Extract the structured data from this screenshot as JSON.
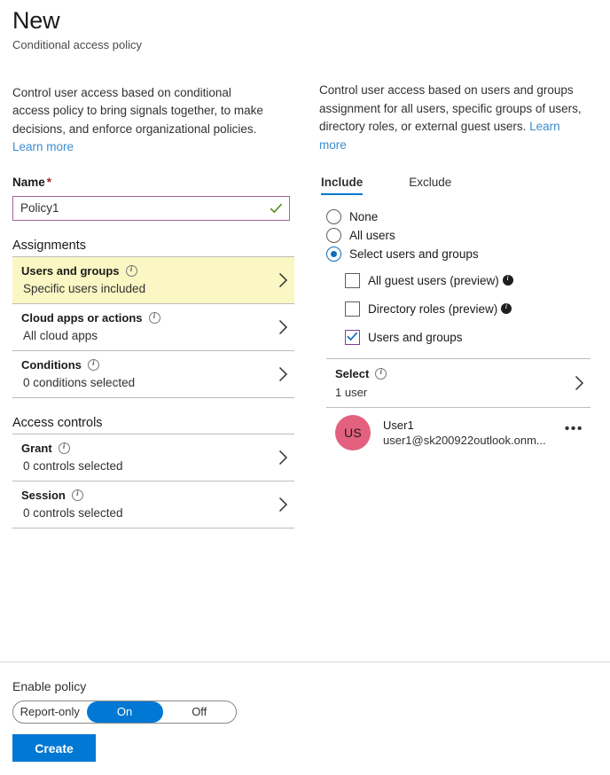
{
  "blade": {
    "title": "New",
    "subtitle": "Conditional access policy"
  },
  "left": {
    "intro_text": "Control user access based on conditional access policy to bring signals together, to make decisions, and enforce organizational policies. ",
    "intro_link": "Learn more",
    "name_label": "Name",
    "name_required_mark": "*",
    "name_value": "Policy1",
    "name_placeholder": "",
    "assignments_heading": "Assignments",
    "assignment_rows": [
      {
        "title": "Users and groups",
        "value": "Specific users included"
      },
      {
        "title": "Cloud apps or actions",
        "value": "All cloud apps"
      },
      {
        "title": "Conditions",
        "value": "0 conditions selected"
      }
    ],
    "access_controls_heading": "Access controls",
    "control_rows": [
      {
        "title": "Grant",
        "value": "0 controls selected"
      },
      {
        "title": "Session",
        "value": "0 controls selected"
      }
    ]
  },
  "right": {
    "intro_text": "Control user access based on users and groups assignment for all users, specific groups of users, directory roles, or external guest users.",
    "intro_link": "Learn more",
    "tabs": [
      {
        "label": "Include",
        "active": true
      },
      {
        "label": "Exclude",
        "active": false
      }
    ],
    "radios": [
      {
        "label": "None",
        "selected": false
      },
      {
        "label": "All users",
        "selected": false
      },
      {
        "label": "Select users and groups",
        "selected": true
      }
    ],
    "checkboxes": [
      {
        "label": "All guest users (preview)",
        "checked": false,
        "info": "filled"
      },
      {
        "label": "Directory roles (preview)",
        "checked": false,
        "info": "filled"
      },
      {
        "label": "Users and groups",
        "checked": true,
        "info": "none"
      }
    ],
    "select_row": {
      "title": "Select",
      "value": "1 user"
    },
    "user": {
      "initials": "US",
      "name": "User1",
      "email": "user1@sk200922outlook.onm...",
      "more_label": "•••"
    }
  },
  "footer": {
    "enable_label": "Enable policy",
    "toggle_options": [
      {
        "label": "Report-only",
        "selected": false
      },
      {
        "label": "On",
        "selected": true
      },
      {
        "label": "Off",
        "selected": false
      }
    ],
    "create_label": "Create"
  },
  "colors": {
    "accent_blue": "#0078d4",
    "link_blue": "#3b8cd0",
    "highlight_yellow": "#faf7c4",
    "input_border_purple": "#a4629e",
    "checkbox_purple": "#7b3f98",
    "avatar_pink": "#e3607f",
    "valid_green": "#498205",
    "required_red": "#a4262c"
  }
}
